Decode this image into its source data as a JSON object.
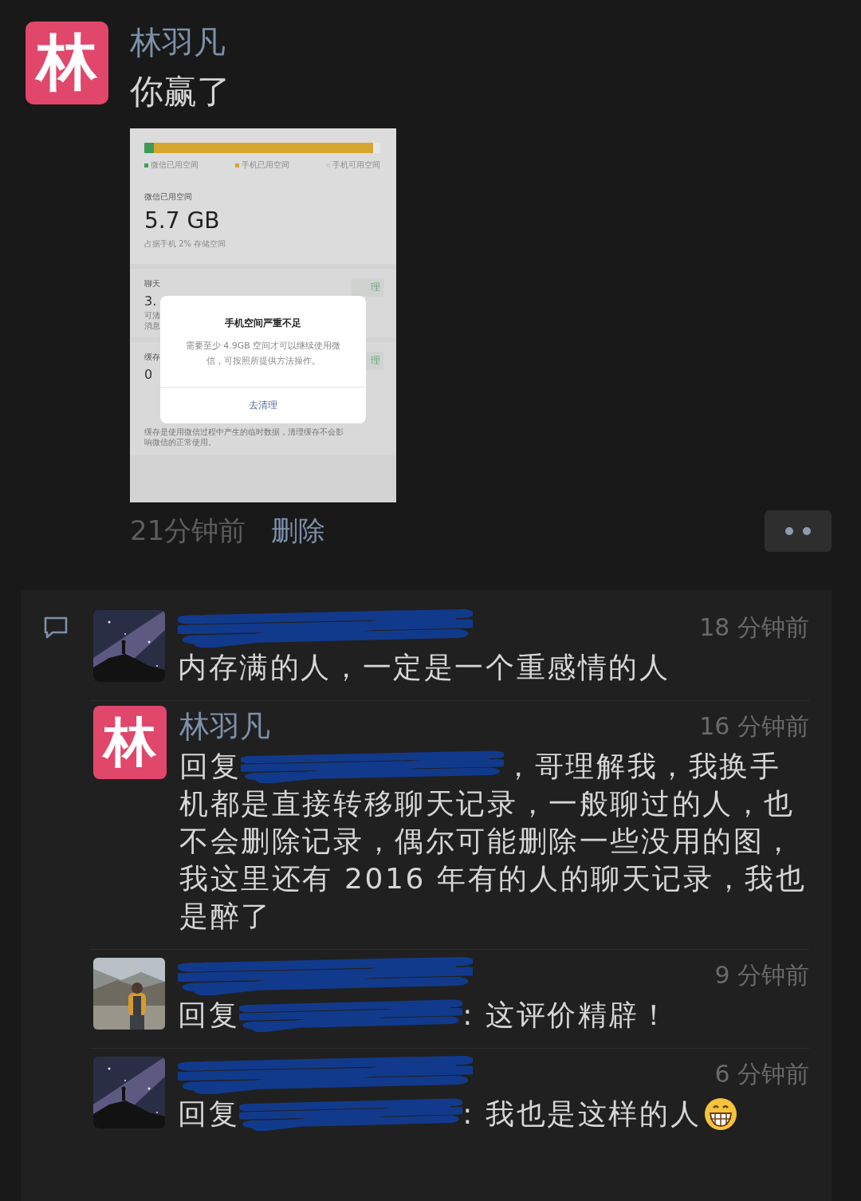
{
  "post": {
    "author": "林羽凡",
    "avatar_text": "林",
    "text": "你赢了",
    "time": "21分钟前",
    "delete_label": "删除",
    "screenshot": {
      "bar": [
        {
          "color": "#3f9a5a",
          "level": 0.04
        },
        {
          "color": "#d6a62e",
          "level": 0.97
        }
      ],
      "legend": [
        {
          "label": "微信已用空间",
          "color": "#3f9a5a"
        },
        {
          "label": "手机已用空间",
          "color": "#d6a62e"
        },
        {
          "label": "手机可用空间",
          "color": "#d0d0d0"
        }
      ],
      "used_label": "微信已用空间",
      "used_value": "5.7 GB",
      "used_note": "占据手机 2% 存储空间",
      "cards": [
        {
          "title": "聊天",
          "value": "3.",
          "desc": [
            "可清",
            "消息"
          ],
          "button": "理"
        },
        {
          "title": "缓存",
          "value": "0",
          "desc": [
            "缓存是使用微信过程中产生的临时数据，清理缓存不会影",
            "响微信的正常使用。"
          ],
          "button": "理"
        }
      ],
      "dialog": {
        "title": "手机空间严重不足",
        "message": "需要至少 4.9GB 空间才可以继续使用微信，可按照所提供方法操作。",
        "button": "去清理"
      }
    }
  },
  "comments": [
    {
      "name_redacted": true,
      "time": "18 分钟前",
      "reply_redacted": false,
      "text": "内存满的人，一定是一个重感情的人",
      "emoji": false
    },
    {
      "avatar": {
        "kind": "logo",
        "text": "林"
      },
      "name": "林羽凡",
      "name_redacted": false,
      "time": "16 分钟前",
      "reply_prefix": "回复",
      "reply_redacted": true,
      "text": "，哥理解我，我换手",
      "continuation": "机都是直接转移聊天记录，一般聊过的人，也不会删除记录，偶尔可能删除一些没用的图，我这里还有 2016 年有的人的聊天记录，我也是醉了",
      "emoji": false
    },
    {
      "name_redacted": true,
      "time": "9 分钟前",
      "reply_prefix": "回复",
      "reply_redacted": true,
      "text": ": 这评价精辟！",
      "emoji": false
    },
    {
      "name_redacted": true,
      "time": "6 分钟前",
      "reply_prefix": "回复",
      "reply_redacted": true,
      "text": ": 我也是这样的人",
      "emoji": true
    }
  ]
}
